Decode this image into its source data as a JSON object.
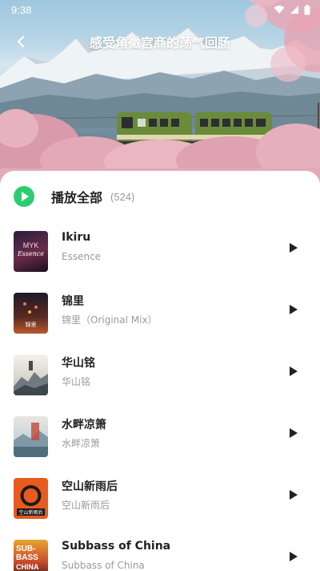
{
  "status_bar": {
    "time": "9:38",
    "icons": [
      "wifi-icon",
      "signal-icon",
      "battery-icon"
    ]
  },
  "header": {
    "title": "感受角徵宫商的荡气回肠",
    "back_icon": "back-arrow-icon"
  },
  "play_all": {
    "label": "播放全部",
    "count": "(524)",
    "icon": "play-circle-icon",
    "accent_color": "#2ecc71"
  },
  "songs": [
    {
      "title": "Ikiru",
      "subtitle": "Essence",
      "cover_text": "Essence",
      "cover_text_top": "MYK",
      "icon": "play-icon"
    },
    {
      "title": "锦里",
      "subtitle": "锦里（Original Mix）",
      "cover_text": "锦里",
      "icon": "play-icon"
    },
    {
      "title": "华山铭",
      "subtitle": "华山铭",
      "cover_text": "",
      "icon": "play-icon"
    },
    {
      "title": "水畔凉箫",
      "subtitle": "水畔凉箫",
      "cover_text": "",
      "icon": "play-icon"
    },
    {
      "title": "空山新雨后",
      "subtitle": "空山新雨后",
      "cover_text": "空山新雨后",
      "icon": "play-icon"
    },
    {
      "title": "Subbass of China",
      "subtitle": "Subbass of China",
      "cover_text_top": "SUB-",
      "cover_text_mid": "BASS",
      "cover_text": "CHINA",
      "icon": "play-icon"
    }
  ],
  "colors": {
    "sheet_bg": "#ffffff",
    "title_text": "#222222",
    "sub_text": "#9a9a9a",
    "accent": "#2ecc71"
  }
}
